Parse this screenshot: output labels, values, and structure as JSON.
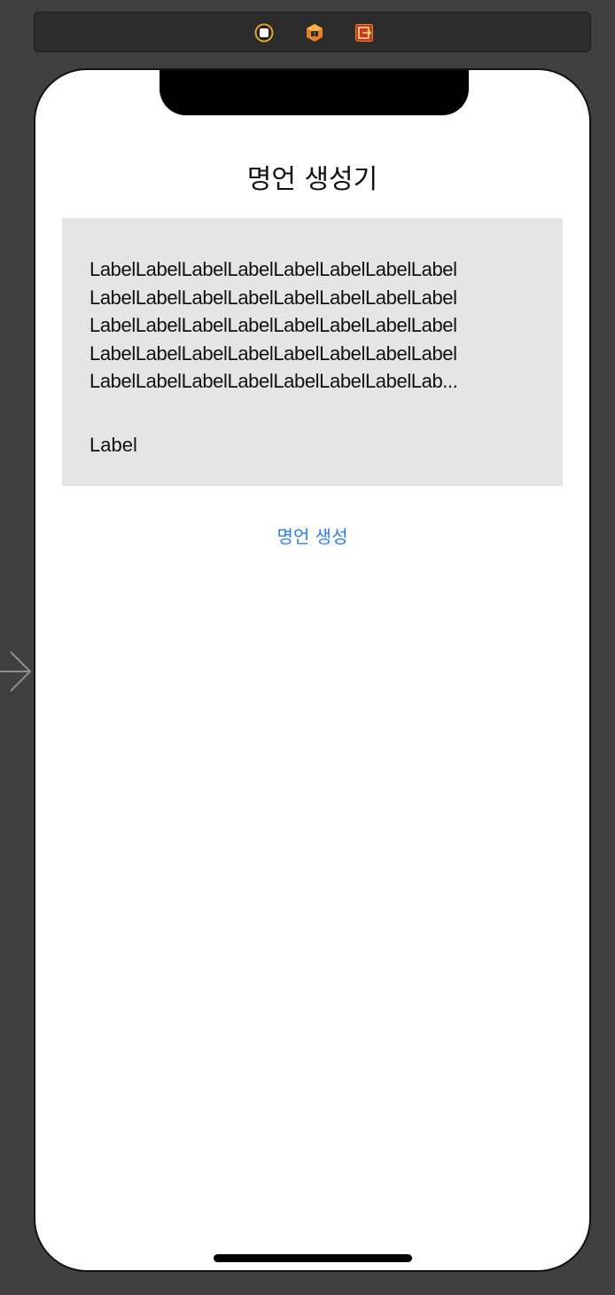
{
  "dock": {
    "icons": [
      "view-controller-icon",
      "first-responder-icon",
      "exit-icon"
    ],
    "accent": "#f5a623"
  },
  "screen": {
    "title": "명언 생성기",
    "quote_text": "LabelLabelLabelLabelLabelLabelLabelLabel\nLabelLabelLabelLabelLabelLabelLabelLabel\nLabelLabelLabelLabelLabelLabelLabelLabel\nLabelLabelLabelLabelLabelLabelLabelLabel\nLabelLabelLabelLabelLabelLabelLabelLab...",
    "author_label": "Label",
    "generate_button_label": "명언 생성"
  },
  "colors": {
    "canvas": "#404040",
    "card": "#e5e5e5",
    "link": "#2f80ed"
  }
}
